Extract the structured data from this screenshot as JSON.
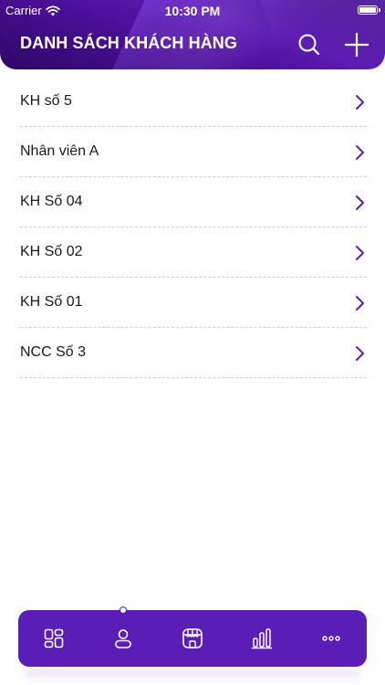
{
  "status_bar": {
    "carrier": "Carrier",
    "time": "10:30 PM"
  },
  "header": {
    "title": "DANH SÁCH KHÁCH HÀNG",
    "search_icon": "search-icon",
    "add_icon": "plus-icon"
  },
  "customers": [
    {
      "name": "KH số 5"
    },
    {
      "name": "Nhân viên A"
    },
    {
      "name": "KH Số 04"
    },
    {
      "name": "KH Số 02"
    },
    {
      "name": "KH Số 01"
    },
    {
      "name": "NCC Số 3"
    }
  ],
  "tabbar": {
    "tabs": [
      {
        "icon": "dashboard-grid-icon"
      },
      {
        "icon": "person-icon",
        "active": true
      },
      {
        "icon": "store-icon"
      },
      {
        "icon": "bar-chart-icon"
      },
      {
        "icon": "more-dots-icon"
      }
    ]
  },
  "colors": {
    "primary": "#5a1db5",
    "header_dark": "#3a0a78",
    "chevron": "#5a1db5",
    "text": "#1a1a1a",
    "divider": "#cfcfcf"
  }
}
